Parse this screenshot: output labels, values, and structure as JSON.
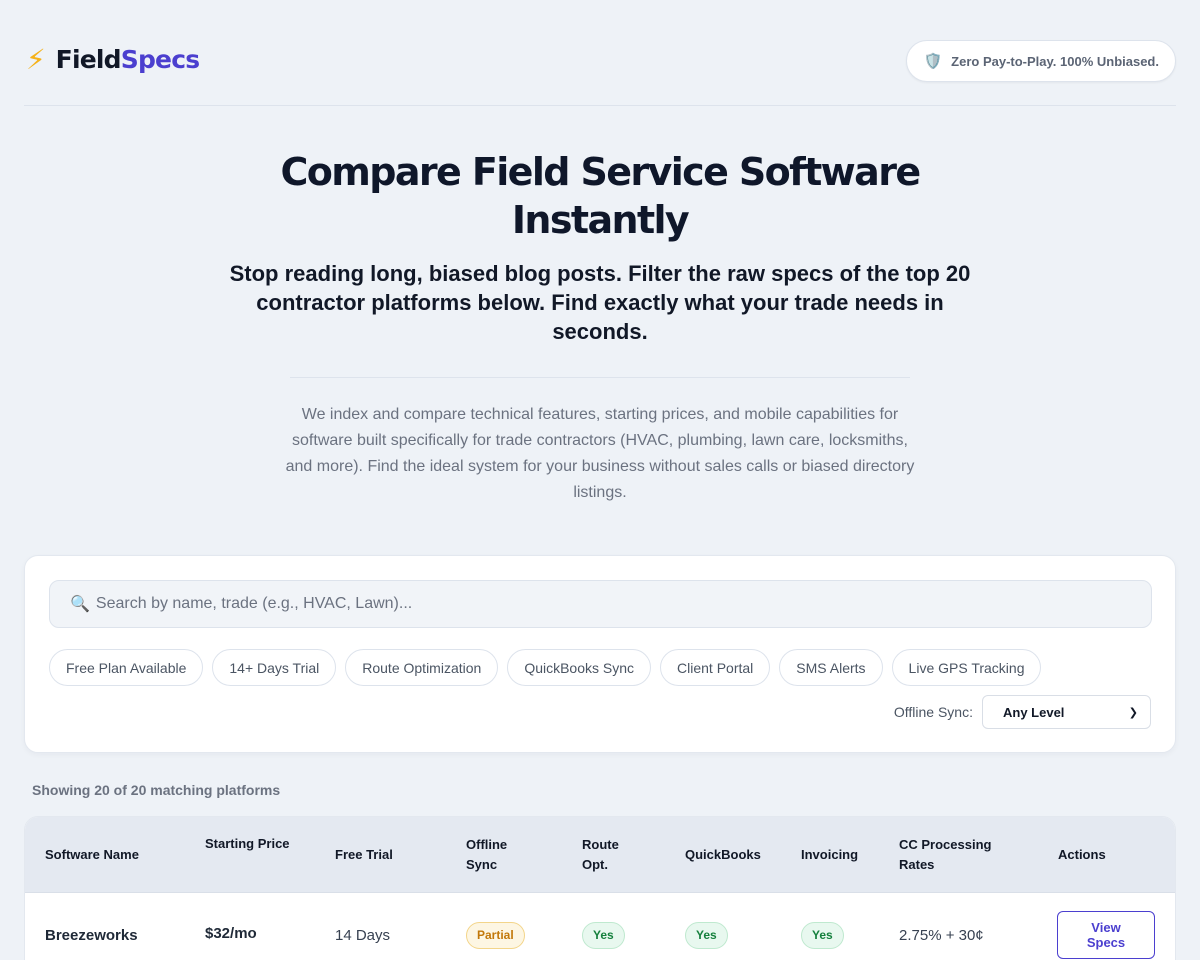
{
  "brand": {
    "logo_icon": "lightning-icon",
    "name_part1": "Field",
    "name_part2": "Specs"
  },
  "header": {
    "badge_icon": "shield-icon",
    "badge_text": "Zero Pay-to-Play. 100% Unbiased."
  },
  "hero": {
    "title": "Compare Field Service Software Instantly",
    "subtitle": "Stop reading long, biased blog posts. Filter the raw specs of the top 20 contractor platforms below. Find exactly what your trade needs in seconds.",
    "description": "We index and compare technical features, starting prices, and mobile capabilities for software built specifically for trade contractors (HVAC, plumbing, lawn care, locksmiths, and more). Find the ideal system for your business without sales calls or biased directory listings."
  },
  "search": {
    "icon": "search-icon",
    "placeholder": "Search by name, trade (e.g., HVAC, Lawn)..."
  },
  "filters": {
    "chips": [
      "Free Plan Available",
      "14+ Days Trial",
      "Route Optimization",
      "QuickBooks Sync",
      "Client Portal",
      "SMS Alerts",
      "Live GPS Tracking"
    ],
    "offline_label": "Offline Sync:",
    "offline_value": "Any Level"
  },
  "results": {
    "count_text": "Showing 20 of 20 matching platforms"
  },
  "table": {
    "headers": [
      "Software Name",
      "Starting Price",
      "Free Trial",
      "Offline Sync",
      "Route Opt.",
      "QuickBooks",
      "Invoicing",
      "CC Processing Rates",
      "Actions"
    ],
    "rows": [
      {
        "name": "Breezeworks",
        "price": "$32/mo",
        "trial": "14 Days",
        "offline": "Partial",
        "route": "Yes",
        "quickbooks": "Yes",
        "invoicing": "Yes",
        "cc_rates": "2.75% + 30¢",
        "action": "View Specs"
      }
    ]
  },
  "colors": {
    "accent": "#4b3fcf",
    "background": "#eef2f7",
    "yes": "#15803d",
    "partial": "#c2780a"
  }
}
